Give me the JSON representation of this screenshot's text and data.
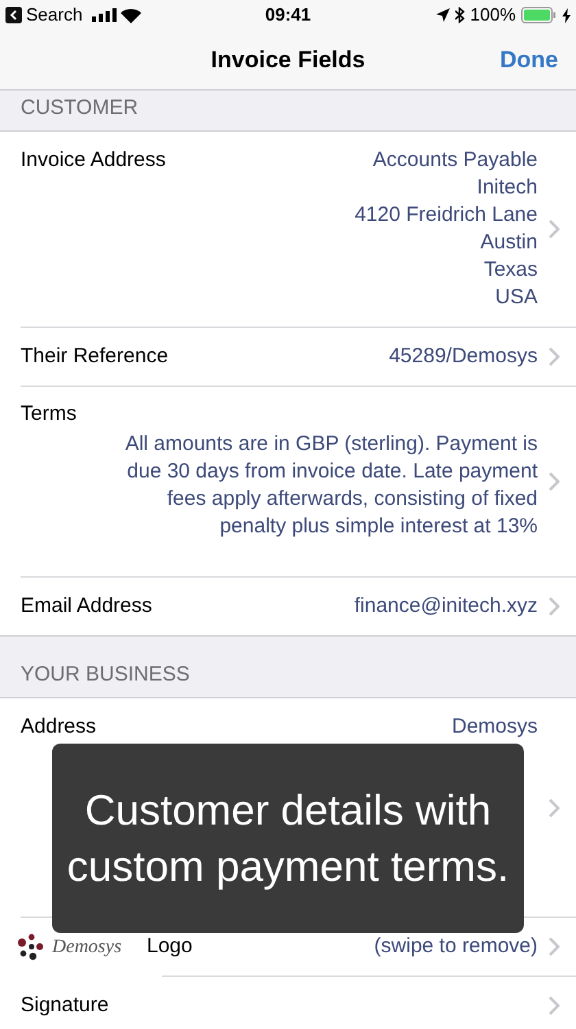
{
  "status_bar": {
    "back_label": "Search",
    "time": "09:41",
    "battery": "100%"
  },
  "nav": {
    "title": "Invoice Fields",
    "done": "Done"
  },
  "sections": [
    {
      "header": "CUSTOMER",
      "rows": [
        {
          "kind": "lines",
          "label": "Invoice Address",
          "lines": [
            "Accounts Payable",
            "Initech",
            "4120 Freidrich Lane",
            "Austin",
            "Texas",
            "USA"
          ]
        },
        {
          "kind": "value",
          "label": "Their Reference",
          "value": "45289/Demosys"
        },
        {
          "kind": "paragraph",
          "label": "Terms",
          "value": "All amounts are in GBP (sterling). Payment is due 30 days from invoice date. Late payment fees apply afterwards, consisting of fixed penalty plus simple interest at 13%"
        },
        {
          "kind": "value",
          "label": "Email Address",
          "value": "finance@initech.xyz"
        }
      ]
    },
    {
      "header": "YOUR BUSINESS",
      "rows": [
        {
          "kind": "lines",
          "label": "Address",
          "lines": [
            "Demosys"
          ]
        },
        {
          "kind": "logo",
          "label": "Logo",
          "logo_text": "Demosys",
          "value": "(swipe to remove)"
        },
        {
          "kind": "value",
          "label": "Signature"
        }
      ]
    }
  ],
  "caption": "Customer details with custom payment terms."
}
